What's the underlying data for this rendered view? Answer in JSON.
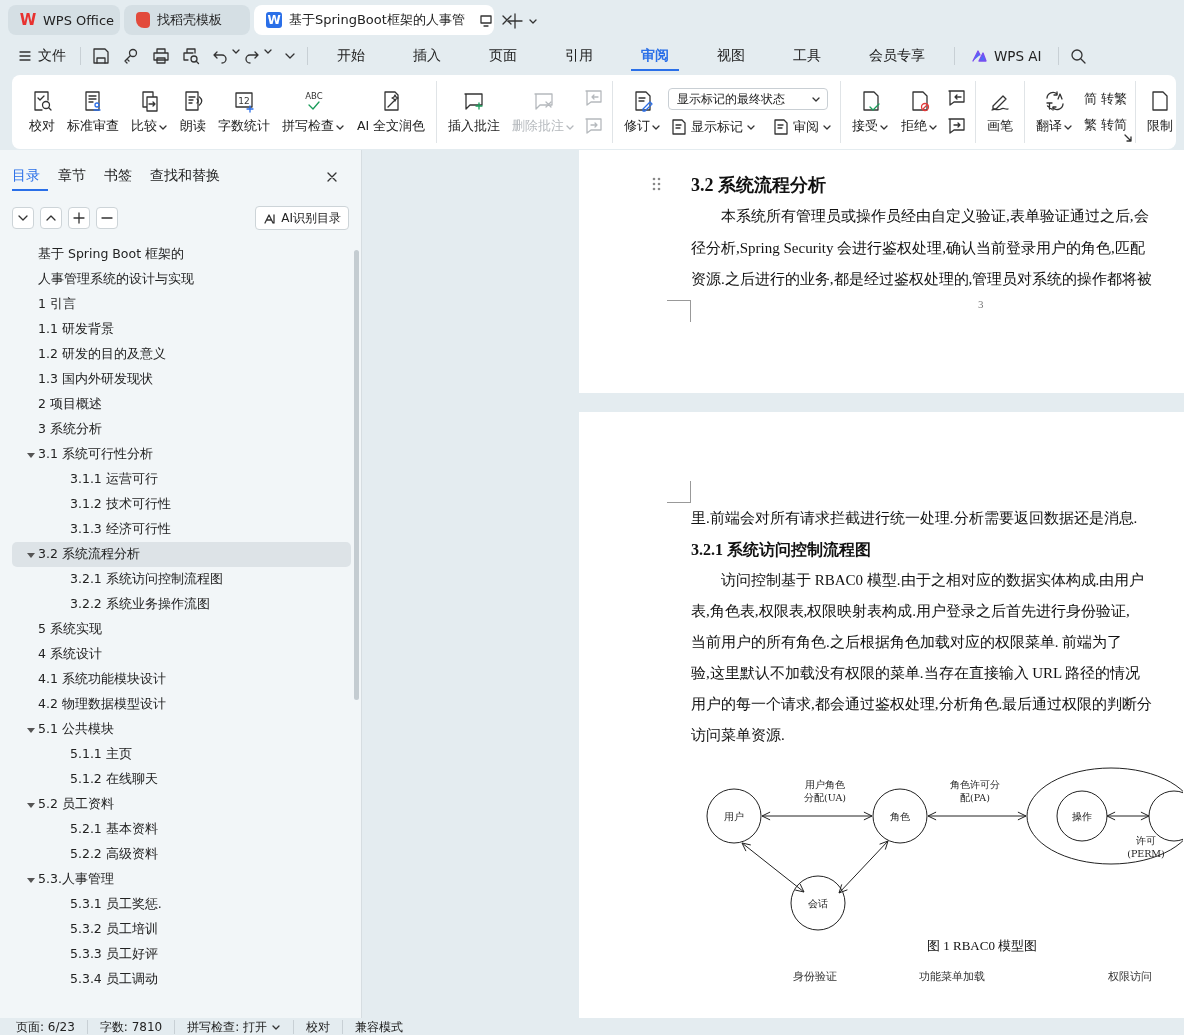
{
  "tabs": [
    {
      "kind": "home",
      "label": "WPS Office",
      "logo_text": "W",
      "selected": false
    },
    {
      "kind": "template",
      "label": "找稻壳模板",
      "selected": false
    },
    {
      "kind": "document",
      "label": "基于SpringBoot框架的人事管",
      "logo_text": "W",
      "selected": true
    }
  ],
  "menu": {
    "file": "文件",
    "tabs": [
      {
        "label": "开始",
        "selected": false
      },
      {
        "label": "插入",
        "selected": false
      },
      {
        "label": "页面",
        "selected": false
      },
      {
        "label": "引用",
        "selected": false
      },
      {
        "label": "审阅",
        "selected": true
      },
      {
        "label": "视图",
        "selected": false
      },
      {
        "label": "工具",
        "selected": false
      },
      {
        "label": "会员专享",
        "selected": false
      }
    ],
    "ai": "WPS AI"
  },
  "ribbon": {
    "groups": [
      {
        "items": [
          {
            "kind": "large",
            "label": "校对",
            "has_menu": false,
            "disabled": false
          },
          {
            "kind": "large",
            "label": "标准审查",
            "has_menu": false,
            "disabled": false
          },
          {
            "kind": "large",
            "label": "比较",
            "has_menu": true,
            "disabled": false
          },
          {
            "kind": "large",
            "label": "朗读",
            "has_menu": false,
            "disabled": false
          },
          {
            "kind": "large",
            "label": "字数统计",
            "icon_text": "12",
            "has_menu": false,
            "disabled": false
          },
          {
            "kind": "large",
            "label": "拼写检查",
            "icon_text": "ABC",
            "has_menu": true,
            "disabled": false
          },
          {
            "kind": "large",
            "label": "AI 全文润色",
            "has_menu": false,
            "disabled": false
          }
        ]
      },
      {
        "items": [
          {
            "kind": "large",
            "label": "插入批注",
            "has_menu": false,
            "disabled": false
          },
          {
            "kind": "large",
            "label": "删除批注",
            "has_menu": true,
            "disabled": true
          },
          {
            "kind": "icon_stack",
            "buttons": [
              {
                "disabled": true
              },
              {
                "disabled": true
              }
            ]
          }
        ]
      },
      {
        "items": [
          {
            "kind": "large",
            "label": "修订",
            "has_menu": true,
            "disabled": false
          },
          {
            "kind": "column",
            "rows": [
              [
                {
                  "kind": "select",
                  "value": "显示标记的最终状态"
                }
              ],
              [
                {
                  "kind": "inline",
                  "label": "显示标记",
                  "has_menu": true
                },
                {
                  "kind": "inline",
                  "label": "审阅",
                  "has_menu": true
                }
              ]
            ]
          }
        ]
      },
      {
        "items": [
          {
            "kind": "large",
            "label": "接受",
            "has_menu": true,
            "disabled": false
          },
          {
            "kind": "large",
            "label": "拒绝",
            "has_menu": true,
            "disabled": false
          },
          {
            "kind": "icon_stack",
            "buttons": [
              {
                "disabled": false
              },
              {
                "disabled": false
              }
            ]
          }
        ]
      },
      {
        "items": [
          {
            "kind": "large",
            "label": "画笔",
            "has_menu": false,
            "disabled": false
          }
        ]
      },
      {
        "items": [
          {
            "kind": "large",
            "label": "翻译",
            "has_menu": true,
            "disabled": false
          },
          {
            "kind": "column",
            "rows": [
              [
                {
                  "kind": "inline",
                  "label": "转繁",
                  "icon_text": "简",
                  "has_menu": false
                }
              ],
              [
                {
                  "kind": "inline",
                  "label": "转简",
                  "icon_text": "繁",
                  "has_menu": false
                }
              ]
            ]
          }
        ]
      },
      {
        "items": [
          {
            "kind": "large",
            "label": "限制",
            "has_menu": false,
            "disabled": false
          }
        ]
      }
    ]
  },
  "sidebar": {
    "tabs": [
      {
        "label": "目录",
        "selected": true
      },
      {
        "label": "章节",
        "selected": false
      },
      {
        "label": "书签",
        "selected": false
      },
      {
        "label": "查找和替换",
        "selected": false
      }
    ],
    "ai_button": "AI识别目录",
    "outline": [
      {
        "label": "基于 Spring Boot 框架的",
        "selected": false
      },
      {
        "label": "人事管理系统的设计与实现",
        "selected": false
      },
      {
        "label": "1 引言",
        "selected": false
      },
      {
        "label": "1.1 研发背景",
        "selected": false
      },
      {
        "label": "1.2 研发的目的及意义",
        "selected": false
      },
      {
        "label": "1.3 国内外研发现状",
        "selected": false
      },
      {
        "label": "2 项目概述",
        "selected": false
      },
      {
        "label": "3 系统分析",
        "selected": false
      },
      {
        "label": "3.1 系统可行性分析",
        "selected": false,
        "expanded": true,
        "children": [
          {
            "label": "3.1.1 运营可行",
            "selected": false
          },
          {
            "label": "3.1.2 技术可行性",
            "selected": false
          },
          {
            "label": "3.1.3 经济可行性",
            "selected": false
          }
        ]
      },
      {
        "label": "3.2 系统流程分析",
        "selected": true,
        "expanded": true,
        "children": [
          {
            "label": "3.2.1 系统访问控制流程图",
            "selected": false
          },
          {
            "label": "3.2.2 系统业务操作流图",
            "selected": false
          }
        ]
      },
      {
        "label": "5 系统实现",
        "selected": false
      },
      {
        "label": "4 系统设计",
        "selected": false
      },
      {
        "label": "4.1 系统功能模块设计",
        "selected": false
      },
      {
        "label": "4.2 物理数据模型设计",
        "selected": false
      },
      {
        "label": "5.1  公共模块",
        "selected": false,
        "expanded": true,
        "children": [
          {
            "label": "5.1.1 主页",
            "selected": false
          },
          {
            "label": "5.1.2 在线聊天",
            "selected": false
          }
        ]
      },
      {
        "label": "5.2  员工资料",
        "selected": false,
        "expanded": true,
        "children": [
          {
            "label": "5.2.1 基本资料",
            "selected": false
          },
          {
            "label": "5.2.2  高级资料",
            "selected": false
          }
        ]
      },
      {
        "label": "5.3.人事管理",
        "selected": false,
        "expanded": true,
        "children": [
          {
            "label": "5.3.1 员工奖惩.",
            "selected": false
          },
          {
            "label": "5.3.2 员工培训",
            "selected": false
          },
          {
            "label": "5.3.3 员工好评",
            "selected": false
          },
          {
            "label": "5.3.4 员工调动",
            "selected": false
          }
        ]
      }
    ]
  },
  "document": {
    "pages": [
      {
        "blocks": [
          {
            "kind": "heading",
            "text": "3.2 系统流程分析"
          },
          {
            "kind": "paragraph",
            "indent": true,
            "lines": [
              "本系统所有管理员或操作员经由自定义验证,表单验证通过之后,会",
              "径分析,Spring Security 会进行鉴权处理,确认当前登录用户的角色,匹配",
              "资源.之后进行的业务,都是经过鉴权处理的,管理员对系统的操作都将被"
            ]
          }
        ],
        "page_number": "3"
      },
      {
        "blocks": [
          {
            "kind": "paragraph",
            "indent": false,
            "lines": [
              "里.前端会对所有请求拦截进行统一处理.分析需要返回数据还是消息."
            ]
          },
          {
            "kind": "subheading",
            "text": "3.2.1 系统访问控制流程图"
          },
          {
            "kind": "paragraph",
            "indent": true,
            "lines": [
              "访问控制基于 RBAC0 模型.由于之相对应的数据实体构成.由用户",
              "表,角色表,权限表,权限映射表构成.用户登录之后首先进行身份验证,",
              "当前用户的所有角色.之后根据角色加载对应的权限菜单. 前端为了",
              "验,这里默认不加载没有权限的菜单.当存在直接输入 URL 路径的情况",
              "用户的每一个请求,都会通过鉴权处理,分析角色.最后通过权限的判断分",
              "访问菜单资源."
            ]
          },
          {
            "kind": "diagram",
            "nodes": [
              "用户",
              "角色",
              "会话",
              "操作"
            ],
            "edge_labels": [
              [
                "用户角色",
                "分配(UA)"
              ],
              [
                "角色许可分",
                "配(PA)"
              ],
              [
                "许可",
                "(PERM)"
              ]
            ]
          },
          {
            "kind": "caption",
            "text": "图 1 RBAC0 模型图"
          },
          {
            "kind": "labels",
            "items": [
              "身份验证",
              "功能菜单加载",
              "权限访问"
            ]
          }
        ]
      }
    ]
  },
  "status_bar": [
    {
      "label": "页面: 6/23",
      "has_menu": false
    },
    {
      "label": "字数: 7810",
      "has_menu": false
    },
    {
      "label": "拼写检查: 打开",
      "has_menu": true
    },
    {
      "label": "校对",
      "has_menu": false
    },
    {
      "label": "兼容模式",
      "has_menu": false
    }
  ]
}
